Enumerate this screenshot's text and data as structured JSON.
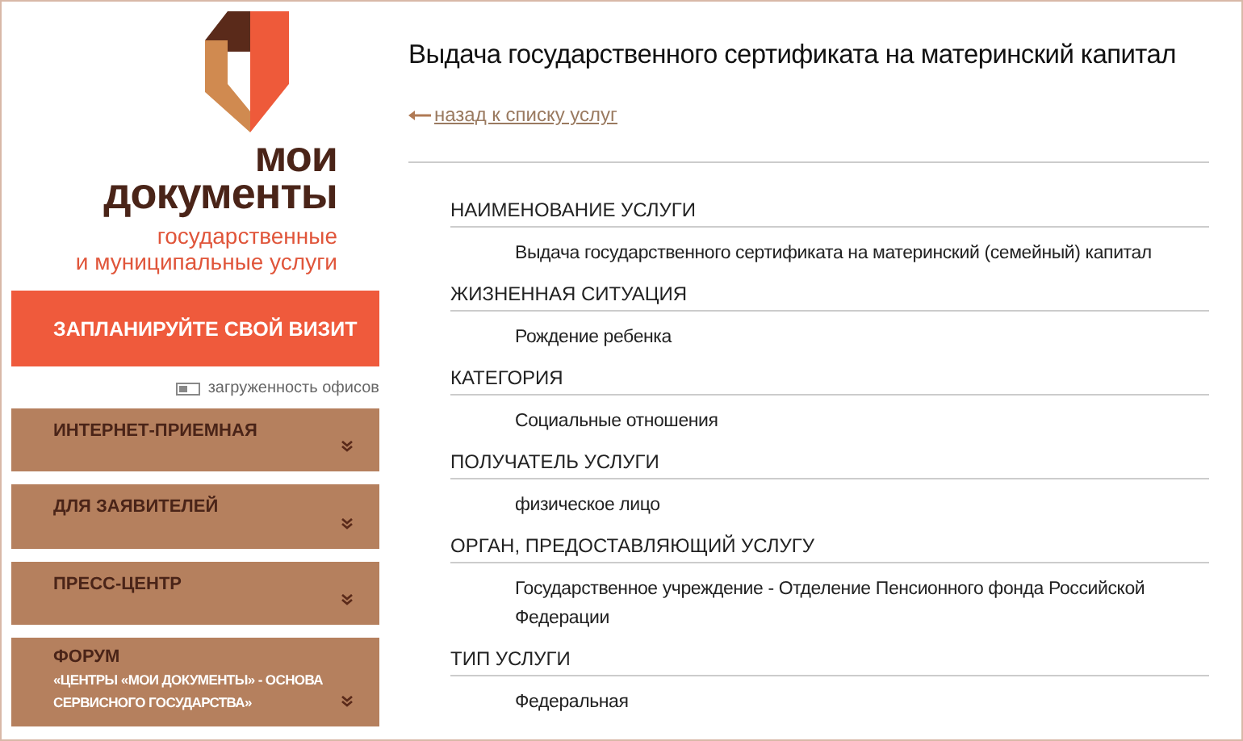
{
  "logo": {
    "title_line_1": "мои",
    "title_line_2": "документы",
    "subtitle_line_1": "государственные",
    "subtitle_line_2": "и муниципальные услуги"
  },
  "visit_button": "ЗАПЛАНИРУЙТЕ СВОЙ ВИЗИТ",
  "office_load": "загруженность офисов",
  "menu": [
    {
      "label": "ИНТЕРНЕТ-ПРИЕМНАЯ"
    },
    {
      "label": "ДЛЯ ЗАЯВИТЕЛЕЙ"
    },
    {
      "label": "ПРЕСС-ЦЕНТР"
    },
    {
      "label": "ФОРУМ",
      "sublabel": "«ЦЕНТРЫ «МОИ ДОКУМЕНТЫ» - ОСНОВА СЕРВИСНОГО ГОСУДАРСТВА»"
    }
  ],
  "page_title": "Выдача государственного сертификата на материнский капитал",
  "back_link": "назад к списку услуг",
  "fields": [
    {
      "label": "НАИМЕНОВАНИЕ УСЛУГИ",
      "value": "Выдача государственного сертификата на материнский (семейный) капитал"
    },
    {
      "label": "ЖИЗНЕННАЯ СИТУАЦИЯ",
      "value": "Рождение ребенка"
    },
    {
      "label": "КАТЕГОРИЯ",
      "value": "Социальные отношения"
    },
    {
      "label": "ПОЛУЧАТЕЛЬ УСЛУГИ",
      "value": "физическое лицо"
    },
    {
      "label": "ОРГАН, ПРЕДОСТАВЛЯЮЩИЙ УСЛУГУ",
      "value": "Государственное учреждение - Отделение Пенсионного фонда Российской Федерации"
    },
    {
      "label": "ТИП УСЛУГИ",
      "value": "Федеральная"
    }
  ]
}
